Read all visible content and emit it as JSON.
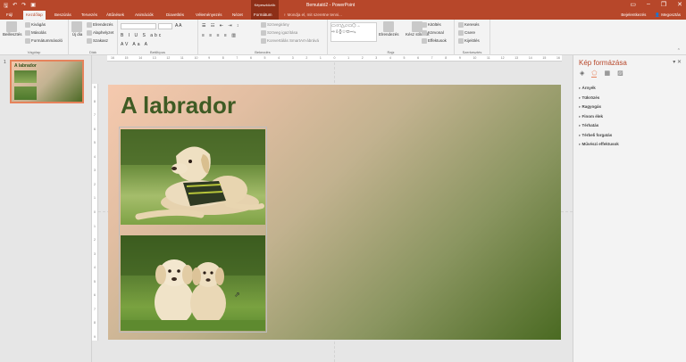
{
  "titlebar": {
    "context_tools": "Képeszközök",
    "doc_title": "Bemutató2 - PowerPoint",
    "controls": [
      "▭",
      "–",
      "❐",
      "✕"
    ]
  },
  "tabs": [
    {
      "label": "Fájl"
    },
    {
      "label": "Kezdőlap"
    },
    {
      "label": "Beszúrás"
    },
    {
      "label": "Tervezés"
    },
    {
      "label": "Áttűnések"
    },
    {
      "label": "Animációk"
    },
    {
      "label": "Diavetítés"
    },
    {
      "label": "Véleményezés"
    },
    {
      "label": "Nézet"
    },
    {
      "label": "Formátum"
    }
  ],
  "tell_me": "Mondja el, mit szeretne tenni...",
  "account": {
    "signin": "Bejelentkezés",
    "share": "Megosztás"
  },
  "ribbon": {
    "paste": "Beillesztés",
    "cut": "Kivágás",
    "copy": "Másolás",
    "format_painter": "Formátummásoló",
    "clipboard": "Vágólap",
    "new_slide": "Új dia",
    "layout": "Elrendezés",
    "reset": "Alaphelyzet",
    "section": "Szakasz",
    "slides": "Diák",
    "font": "Betűtípus",
    "text_dir": "Szövegirány",
    "align_text": "Szöveg igazítása",
    "smartart": "Konvertálás SmartArt-ábrává",
    "paragraph": "Bekezdés",
    "arrange": "Elrendezés",
    "quick_styles": "Kész stílusok",
    "shape_fill": "Kitöltés",
    "shape_outline": "Körvonal",
    "shape_effects": "Effektusok",
    "drawing": "Rajz",
    "find": "Keresés",
    "replace": "Csere",
    "select": "Kijelölés",
    "editing": "Szerkesztés"
  },
  "slide_thumb": {
    "number": "1",
    "title": "A labrador"
  },
  "slide": {
    "title": "A labrador"
  },
  "ruler_h": [
    "16",
    "15",
    "14",
    "13",
    "12",
    "11",
    "10",
    "9",
    "8",
    "7",
    "6",
    "5",
    "4",
    "3",
    "2",
    "1",
    "0",
    "1",
    "2",
    "3",
    "4",
    "5",
    "6",
    "7",
    "8",
    "9",
    "10",
    "11",
    "12",
    "13",
    "14",
    "15",
    "16"
  ],
  "ruler_v": [
    "9",
    "8",
    "7",
    "6",
    "5",
    "4",
    "3",
    "2",
    "1",
    "0",
    "1",
    "2",
    "3",
    "4",
    "5",
    "6",
    "7",
    "8",
    "9"
  ],
  "format_pane": {
    "title": "Kép formázása",
    "sections": [
      "Árnyék",
      "Tükrözés",
      "Ragyogás",
      "Finom élek",
      "Térhatás",
      "Térbeli forgatás",
      "Művészi effektusok"
    ]
  }
}
